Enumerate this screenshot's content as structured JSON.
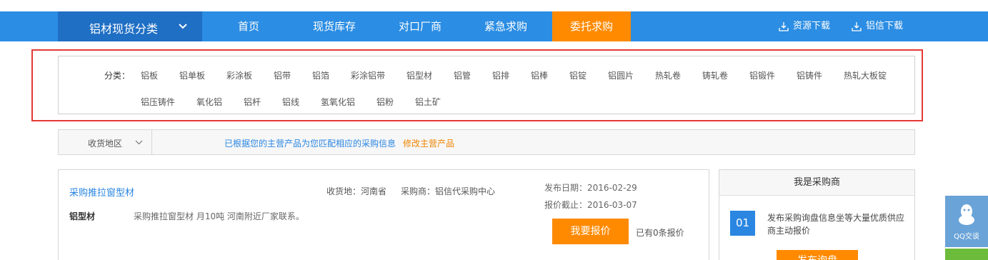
{
  "nav": {
    "category_button": "铝材现货分类",
    "items": [
      "首页",
      "现货库存",
      "对口厂商",
      "紧急求购",
      "委托求购"
    ],
    "active_index": 4,
    "downloads": [
      "资源下载",
      "铝信下载"
    ],
    "colors": {
      "bar": "#2b8de3",
      "category_bg": "#1f6fc4",
      "active": "#ff8a00"
    }
  },
  "categories": {
    "label": "分类：",
    "items": [
      "铝板",
      "铝单板",
      "彩涂板",
      "铝带",
      "铝箔",
      "彩涂铝带",
      "铝型材",
      "铝管",
      "铝排",
      "铝棒",
      "铝锭",
      "铝圆片",
      "热轧卷",
      "铸轧卷",
      "铝锻件",
      "铝铸件",
      "热轧大板锭",
      "铝压铸件",
      "氧化铝",
      "铝杆",
      "铝线",
      "氢氧化铝",
      "铝粉",
      "铝土矿"
    ]
  },
  "filter": {
    "region_label": "收货地区",
    "match_info": "已根据您的主营产品为您匹配相应的采购信息",
    "modify_link": "修改主营产品"
  },
  "listing": {
    "title": "采购推拉窗型材",
    "delivery": "收货地：河南省",
    "buyer": "采购商：铝信代采购中心",
    "publish_date": "发布日期：2016-02-29",
    "quote_deadline": "报价截止：2016-03-07",
    "category": "铝型材",
    "description": "采购推拉窗型材 月10吨 河南附近厂家联系。",
    "quote_button": "我要报价",
    "quote_count": "已有0条报价"
  },
  "buyer_panel": {
    "title": "我是采购商",
    "step_number": "01",
    "step_text": "发布采购询盘信息坐等大量优质供应商主动报价",
    "publish_button": "发布询盘"
  },
  "float": {
    "qq_label": "QQ交谈"
  }
}
